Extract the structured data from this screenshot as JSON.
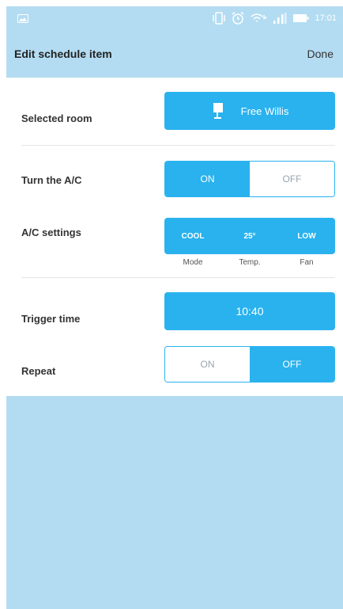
{
  "status_bar": {
    "time": "17:01",
    "icons": [
      "gallery-icon",
      "vibrate-icon",
      "alarm-icon",
      "wifi-icon",
      "signal-icon",
      "battery-icon"
    ]
  },
  "header": {
    "title": "Edit schedule item",
    "done_label": "Done"
  },
  "room": {
    "label": "Selected room",
    "value": "Free Willis",
    "icon": "lamp-icon"
  },
  "ac_power": {
    "label": "Turn the A/C",
    "on_label": "ON",
    "off_label": "OFF",
    "selected": "ON"
  },
  "ac_settings": {
    "label": "A/C settings",
    "mode": "COOL",
    "temp": "25°",
    "fan": "LOW",
    "mode_caption": "Mode",
    "temp_caption": "Temp.",
    "fan_caption": "Fan"
  },
  "trigger": {
    "label": "Trigger time",
    "value": "10:40"
  },
  "repeat": {
    "label": "Repeat",
    "on_label": "ON",
    "off_label": "OFF",
    "selected": "OFF"
  },
  "colors": {
    "accent": "#29b2ee",
    "background": "#b3dcf2"
  }
}
